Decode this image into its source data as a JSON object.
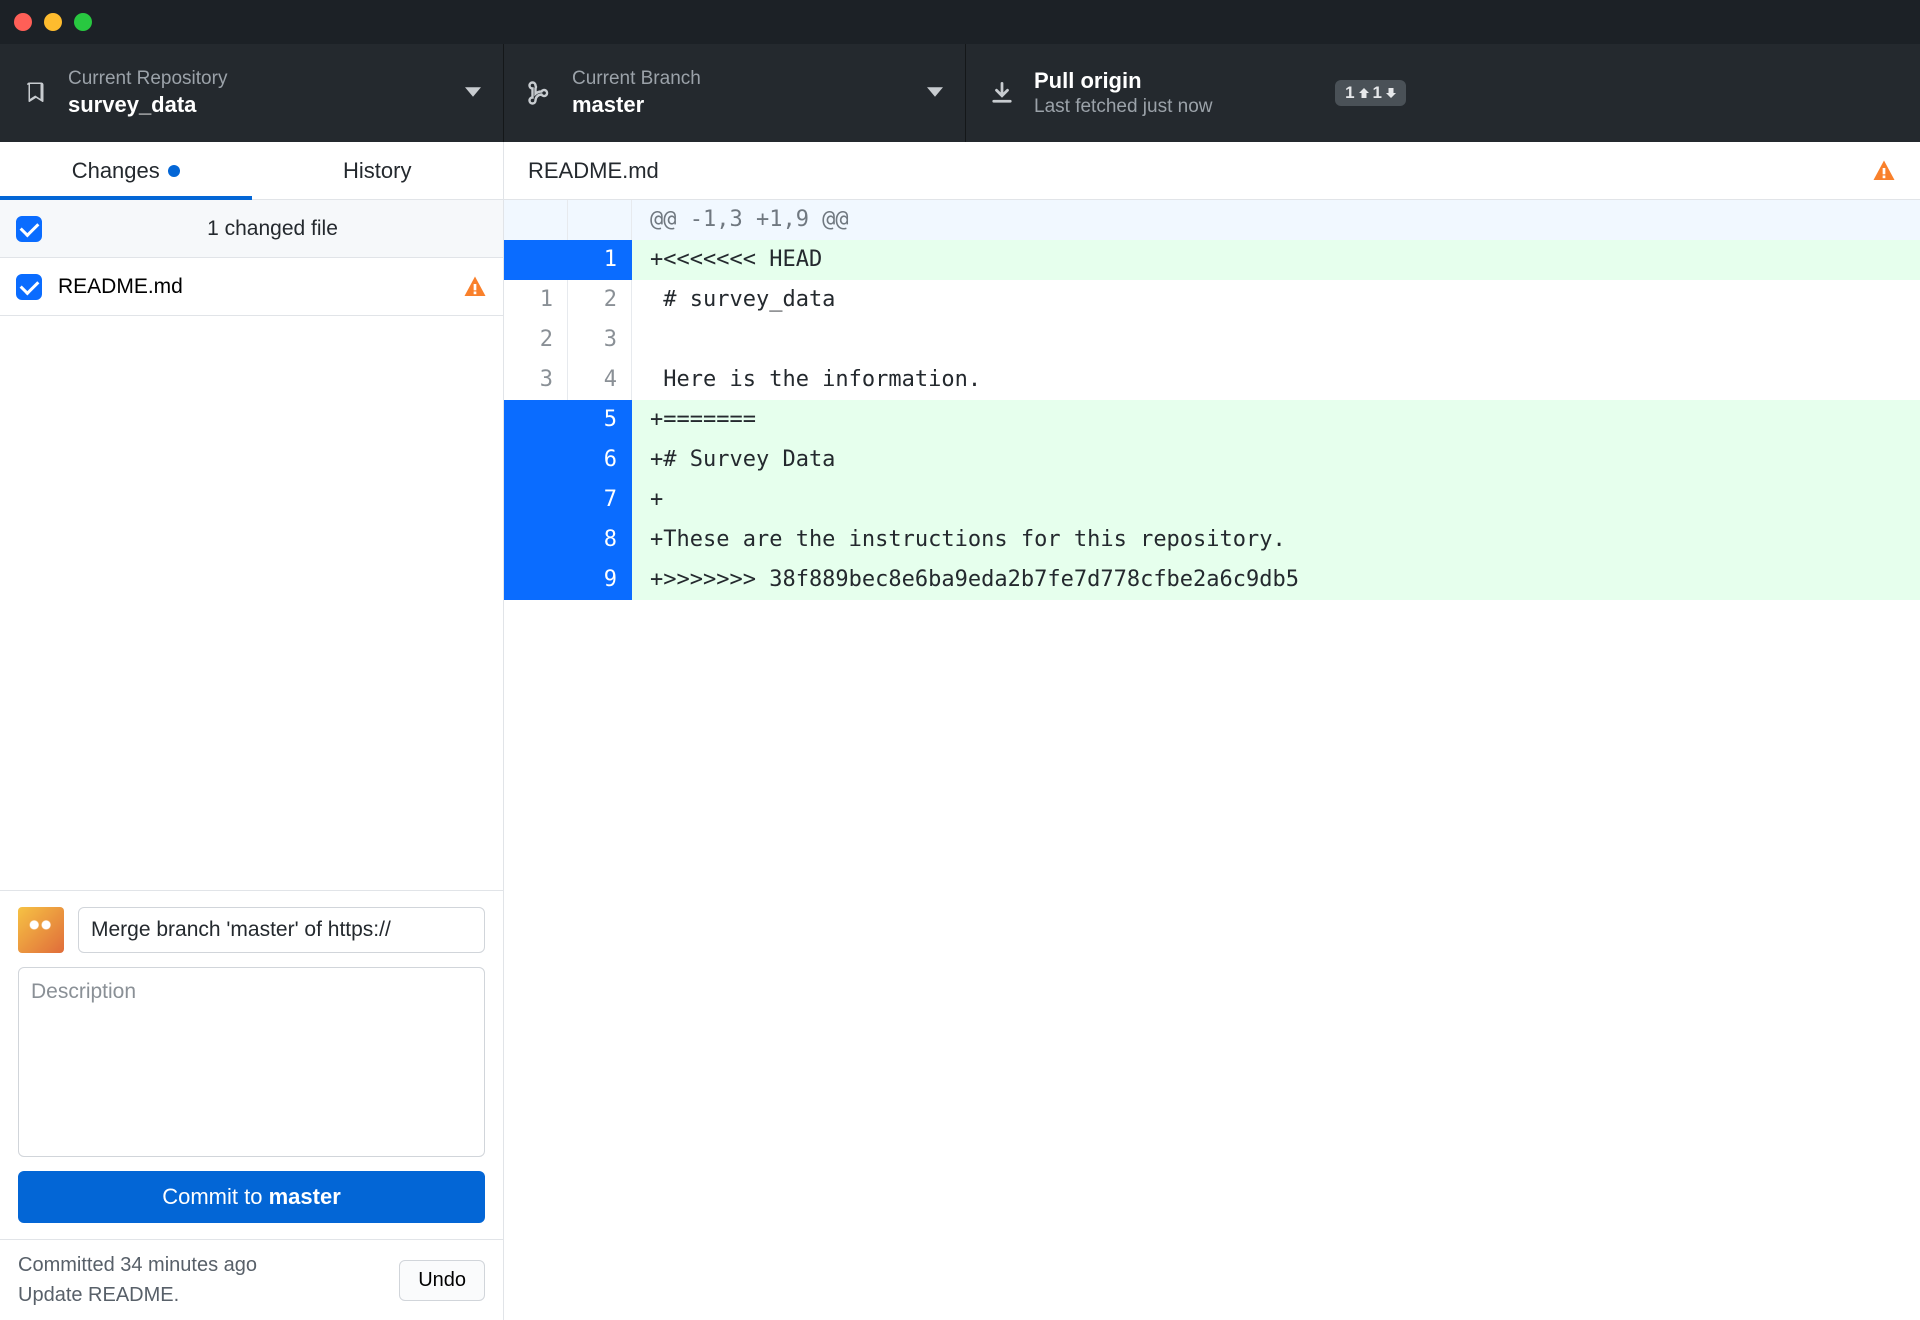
{
  "toolbar": {
    "repo": {
      "label": "Current Repository",
      "value": "survey_data"
    },
    "branch": {
      "label": "Current Branch",
      "value": "master"
    },
    "pull": {
      "title": "Pull origin",
      "sub": "Last fetched just now",
      "badge_up": "1",
      "badge_down": "1"
    }
  },
  "tabs": {
    "changes": "Changes",
    "history": "History"
  },
  "changes": {
    "header": "1 changed file",
    "files": [
      {
        "name": "README.md",
        "checked": true,
        "conflict": true
      }
    ]
  },
  "commit": {
    "summary_value": "Merge branch 'master' of https://",
    "desc_placeholder": "Description",
    "button_prefix": "Commit to ",
    "button_branch": "master"
  },
  "status": {
    "line1": "Committed 34 minutes ago",
    "line2": "Update README.",
    "undo": "Undo"
  },
  "diff": {
    "file": "README.md",
    "conflict": true,
    "rows": [
      {
        "type": "hunk",
        "old": "",
        "new": "",
        "text": "@@ -1,3 +1,9 @@"
      },
      {
        "type": "add",
        "sel": true,
        "old": "",
        "new": "1",
        "text": "+<<<<<<< HEAD"
      },
      {
        "type": "ctx",
        "old": "1",
        "new": "2",
        "text": " # survey_data"
      },
      {
        "type": "ctx",
        "old": "2",
        "new": "3",
        "text": " "
      },
      {
        "type": "ctx",
        "old": "3",
        "new": "4",
        "text": " Here is the information."
      },
      {
        "type": "add",
        "sel": true,
        "old": "",
        "new": "5",
        "text": "+======="
      },
      {
        "type": "add",
        "sel": true,
        "old": "",
        "new": "6",
        "text": "+# Survey Data"
      },
      {
        "type": "add",
        "sel": true,
        "old": "",
        "new": "7",
        "text": "+"
      },
      {
        "type": "add",
        "sel": true,
        "old": "",
        "new": "8",
        "text": "+These are the instructions for this repository."
      },
      {
        "type": "add",
        "sel": true,
        "old": "",
        "new": "9",
        "text": "+>>>>>>> 38f889bec8e6ba9eda2b7fe7d778cfbe2a6c9db5"
      }
    ]
  }
}
